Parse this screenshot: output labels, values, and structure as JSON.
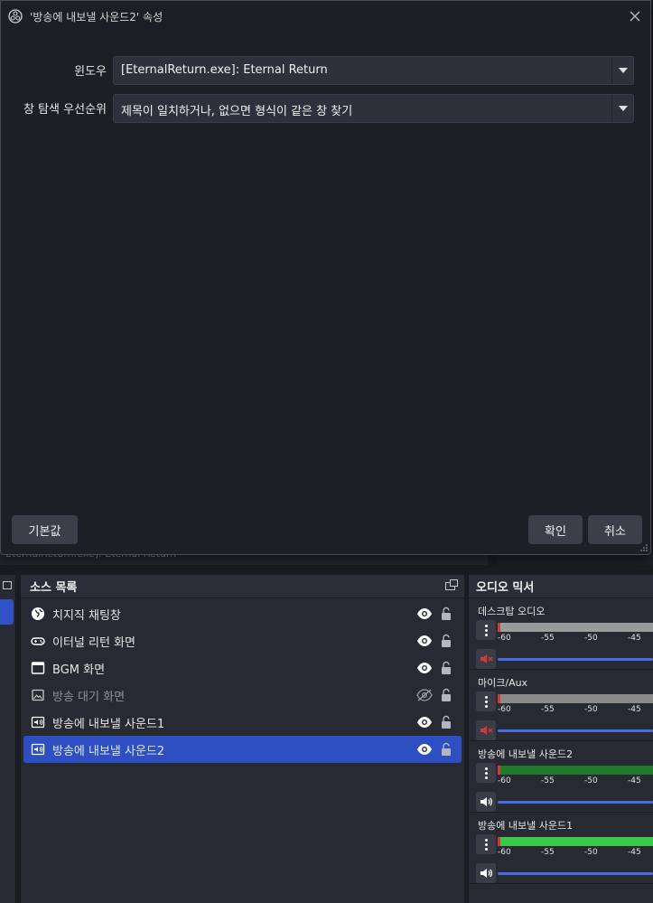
{
  "dialog": {
    "title": "'방송에 내보낼 사운드2' 속성",
    "window_label": "윈도우",
    "window_value": "[EternalReturn.exe]: Eternal Return",
    "priority_label": "창 탐색 우선순위",
    "priority_value": "제목이 일치하거나, 없으면 형식이 같은 창 찾기",
    "defaults_button": "기본값",
    "ok_button": "확인",
    "cancel_button": "취소"
  },
  "background": {
    "partial_text": "EternalReturn.exe]: Eternal Return"
  },
  "sources": {
    "title": "소스 목록",
    "items": [
      {
        "label": "치지직 채팅창",
        "icon": "globe-icon",
        "visible": true,
        "selected": false
      },
      {
        "label": "이터널 리턴 화면",
        "icon": "gamepad-icon",
        "visible": true,
        "selected": false
      },
      {
        "label": "BGM 화면",
        "icon": "window-icon",
        "visible": true,
        "selected": false
      },
      {
        "label": "방송 대기 화면",
        "icon": "image-icon",
        "visible": false,
        "selected": false
      },
      {
        "label": "방송에 내보낼 사운드1",
        "icon": "audio-capture-icon",
        "visible": true,
        "selected": false
      },
      {
        "label": "방송에 내보낼 사운드2",
        "icon": "audio-capture-icon",
        "visible": true,
        "selected": true
      }
    ]
  },
  "mixer": {
    "title": "오디오 믹서",
    "ticks": [
      "-60",
      "-55",
      "-50",
      "-45"
    ],
    "channels": [
      {
        "name": "데스크탑 오디오",
        "muted": true,
        "meter_color": "#9b9b9b",
        "level": 1.0
      },
      {
        "name": "마이크/Aux",
        "muted": true,
        "meter_color": "#8a8a8a",
        "level": 1.0
      },
      {
        "name": "방송에 내보낼 사운드2",
        "muted": false,
        "meter_color": "#1f7a2a",
        "level": 1.0
      },
      {
        "name": "방송에 내보낼 사운드1",
        "muted": false,
        "meter_color": "#3cc94a",
        "level": 1.0
      }
    ]
  },
  "colors": {
    "accent": "#2d4fc2",
    "mute_red": "#d23a3a",
    "slider_blue": "#4a6ae8"
  }
}
